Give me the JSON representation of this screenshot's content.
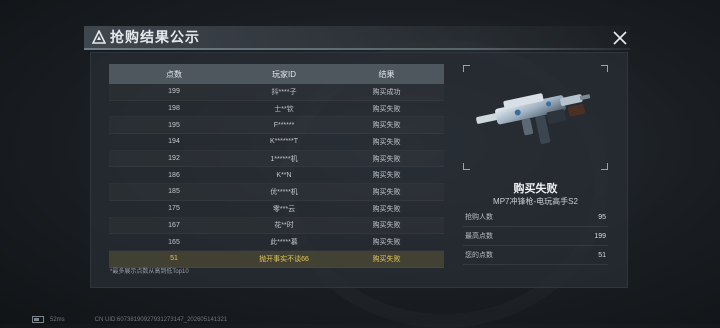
{
  "header": {
    "title": "抢购结果公示"
  },
  "table": {
    "columns": [
      "点数",
      "玩家ID",
      "结果"
    ],
    "rows": [
      {
        "points": "199",
        "player": "抖****子",
        "result": "购买成功"
      },
      {
        "points": "198",
        "player": "士**钦",
        "result": "购买失败"
      },
      {
        "points": "195",
        "player": "F******",
        "result": "购买失败"
      },
      {
        "points": "194",
        "player": "K*******T",
        "result": "购买失败"
      },
      {
        "points": "192",
        "player": "1******机",
        "result": "购买失败"
      },
      {
        "points": "186",
        "player": "K**N",
        "result": "购买失败"
      },
      {
        "points": "185",
        "player": "优*****机",
        "result": "购买失败"
      },
      {
        "points": "175",
        "player": "零***云",
        "result": "购买失败"
      },
      {
        "points": "167",
        "player": "花**时",
        "result": "购买失败"
      },
      {
        "points": "165",
        "player": "此*****慕",
        "result": "购买失败"
      }
    ],
    "my_row": {
      "points": "51",
      "player": "抛开事实不谈66",
      "result": "购买失败"
    }
  },
  "footnote": "*最多展示点数从高到低Top10",
  "result_panel": {
    "status": "购买失败",
    "item_name": "MP7冲锋枪-电玩高手S2",
    "stats": [
      {
        "label": "抢购人数",
        "value": "95"
      },
      {
        "label": "最高点数",
        "value": "199"
      },
      {
        "label": "您的点数",
        "value": "51"
      }
    ]
  },
  "status_bar": {
    "ping": "52ms",
    "uid": "CN UID:60738190927931273147_202605141321"
  },
  "colors": {
    "highlight_row": "#e3c85a",
    "header_bg": "#4e565e"
  }
}
